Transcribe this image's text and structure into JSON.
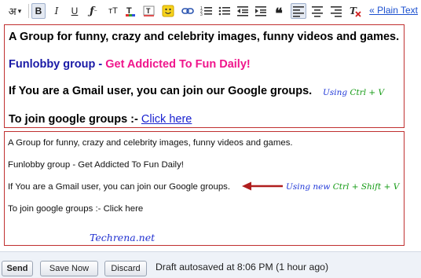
{
  "toolbar": {
    "input_tool_glyph": "अ",
    "input_tool_arrow": "▾",
    "bold": "B",
    "italic": "I",
    "underline": "U",
    "font": "𝓕",
    "font_size": "тT",
    "link_icon": "link-icon",
    "plain_text_link": "« Plain Text"
  },
  "editor": {
    "rich_box": {
      "line1": "A Group for funny, crazy and celebrity images, funny videos and games.",
      "line2_prefix": "Funlobby group - ",
      "line2_highlight": "Get Addicted To Fun Daily!",
      "line3": "If You are a Gmail user, you can join our Google groups.",
      "line4_prefix": "To join google groups :- ",
      "line4_link": "Click here",
      "annotation_word": "Using",
      "annotation_keys": "Ctrl + V"
    },
    "plain_box": {
      "line1": "A Group for funny, crazy and celebrity images, funny videos and games.",
      "line2": "Funlobby group - Get Addicted To Fun Daily!",
      "line3": "If You are a Gmail user, you can join our Google groups.",
      "line4": "To join google groups :- Click here",
      "annotation_word": "Using new",
      "annotation_keys": "Ctrl + Shift + V",
      "watermark": "Techrena.net"
    }
  },
  "bottom": {
    "send": "Send",
    "save_now": "Save Now",
    "discard": "Discard",
    "draft_status": "Draft autosaved at 8:06 PM (1 hour ago)"
  },
  "colors": {
    "line2_prefix": "#1a1aa6",
    "line2_highlight": "#f0168c",
    "link": "#1a22d0",
    "box_border": "#c03030",
    "arrow": "#b01e1e"
  }
}
